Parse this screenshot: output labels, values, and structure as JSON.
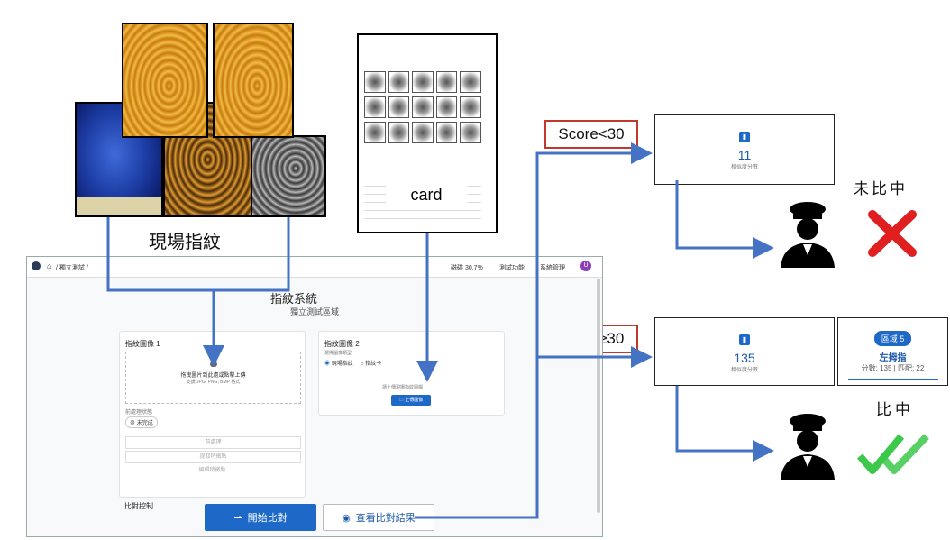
{
  "scene_images": {
    "caption": "現場指紋",
    "card_caption": "card"
  },
  "flow": {
    "low_score_tag": "Score<30",
    "high_score_tag": "Score≥30",
    "low_result_label": "未比中",
    "high_result_label": "比中"
  },
  "score_low": {
    "value": "11",
    "label": "相似度分數"
  },
  "score_high": {
    "value": "135",
    "label": "相似度分數"
  },
  "match_card": {
    "badge": "區域 5",
    "finger": "左拇指",
    "detail": "分數: 135 | 匹配: 22"
  },
  "app": {
    "breadcrumb": "/ 獨立測試 /",
    "status_text": "磁碟 30.7%",
    "menu_test": "測試功能",
    "menu_admin": "系統管理",
    "avatar_letter": "U",
    "title": "指紋系統",
    "subtitle": "獨立測試區域",
    "panel1": {
      "title": "指紋圖像 1",
      "drop_text": "拖曳圖片到此處或點擊上傳",
      "drop_hint": "支援 JPG, PNG, BMP 格式",
      "status_label": "前處理狀態",
      "status_chip": "未完成",
      "btn_preprocess": "前處理",
      "btn_extract": "提取特徵點",
      "btn_edit": "編輯特徵點"
    },
    "panel2": {
      "title": "指紋圖像 2",
      "type_label": "選擇圖像類型",
      "option_scene": "現場指紋",
      "option_card": "指紋卡",
      "upload_hint": "請上傳現場指紋圖檔",
      "upload_btn": "上傳圖像"
    },
    "compare_title": "比對控制",
    "btn_start": "開始比對",
    "btn_results": "查看比對結果"
  },
  "colors": {
    "accent": "#1e68c8",
    "arrow": "#4472c4",
    "tag_border": "#c0392b",
    "check": "#3cc84a",
    "cross": "#e02020"
  }
}
